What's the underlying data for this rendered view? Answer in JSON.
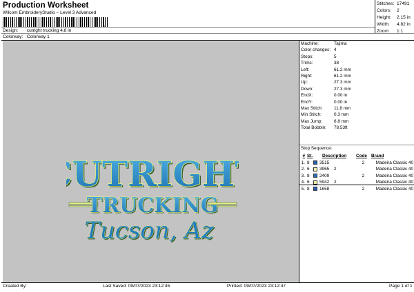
{
  "header": {
    "title": "Production Worksheet",
    "subtitle": "Wilcom EmbroideryStudio – Level 3 Advanced",
    "barcode_tail": ","
  },
  "design_info": {
    "design_label": "Design:",
    "design_value": "cutright trucking 4,8 in",
    "colorway_label": "Colorway:",
    "colorway_value": "Colorway 1"
  },
  "top_stats": [
    {
      "label": "Stitches:",
      "value": "17491"
    },
    {
      "label": "Colors:",
      "value": "2"
    },
    {
      "label": "Height:",
      "value": "2.15 in"
    },
    {
      "label": "Width:",
      "value": "4.82 in"
    },
    {
      "label": "Zoom:",
      "value": "1:1"
    }
  ],
  "artwork": {
    "line1": "CUTRIGHT",
    "line2": "TRUCKING",
    "line3": "Tucson, Az",
    "fill_color": "#2a8fc9",
    "outline_color": "#e2f080",
    "shadow_color": "#3b5d2c"
  },
  "machine_details": [
    {
      "label": "Machine:",
      "value": "Tajima"
    },
    {
      "label": "Color changes:",
      "value": "4"
    },
    {
      "label": "Stops:",
      "value": "5"
    },
    {
      "label": "Trims:",
      "value": "38"
    },
    {
      "label": "Left:",
      "value": "61.2 mm"
    },
    {
      "label": "Right:",
      "value": "61.2 mm"
    },
    {
      "label": "Up:",
      "value": "27.3 mm"
    },
    {
      "label": "Down:",
      "value": "27.3 mm"
    },
    {
      "label": "EndX:",
      "value": "0.00 in"
    },
    {
      "label": "EndY:",
      "value": "0.00 in"
    },
    {
      "label": "Max Stitch:",
      "value": "11.8 mm"
    },
    {
      "label": "Min Stitch:",
      "value": "0.3 mm"
    },
    {
      "label": "Max Jump:",
      "value": "6.8 mm"
    },
    {
      "label": "Total Bobbin:",
      "value": "78.53ft"
    }
  ],
  "stop_sequence": {
    "title": "Stop Sequence:",
    "headers": {
      "num": "#",
      "st": "St.",
      "desc": "Description",
      "code": "Code",
      "brand": "Brand"
    },
    "rows": [
      {
        "num": "1.",
        "st": "8",
        "color": "#1f5fb0",
        "code": "3515",
        "cd": "",
        "desc_num": "2",
        "brand": "Madeira Classic 40"
      },
      {
        "num": "2.",
        "st": "6",
        "color": "#f2ecaa",
        "code": "3965",
        "cd": "2",
        "desc_num": "",
        "brand": "Madeira Classic 40"
      },
      {
        "num": "3.",
        "st": "8",
        "color": "#2c6fbe",
        "code": "2409",
        "cd": "",
        "desc_num": "2",
        "brand": "Madeira Classic 40"
      },
      {
        "num": "4.",
        "st": "6",
        "color": "#f2ecaa",
        "code": "5942",
        "cd": "2",
        "desc_num": "",
        "brand": "Madeira Classic 40"
      },
      {
        "num": "5.",
        "st": "8",
        "color": "#1f5fb0",
        "code": "1658",
        "cd": "",
        "desc_num": "2",
        "brand": "Madeira Classic 40"
      }
    ]
  },
  "footer": {
    "created_by": "Created By:",
    "last_saved": "Last Saved: 09/07/2023 23:12:45",
    "printed": "Printed: 09/07/2023 23:12:47",
    "page": "Page 1 of 1"
  }
}
